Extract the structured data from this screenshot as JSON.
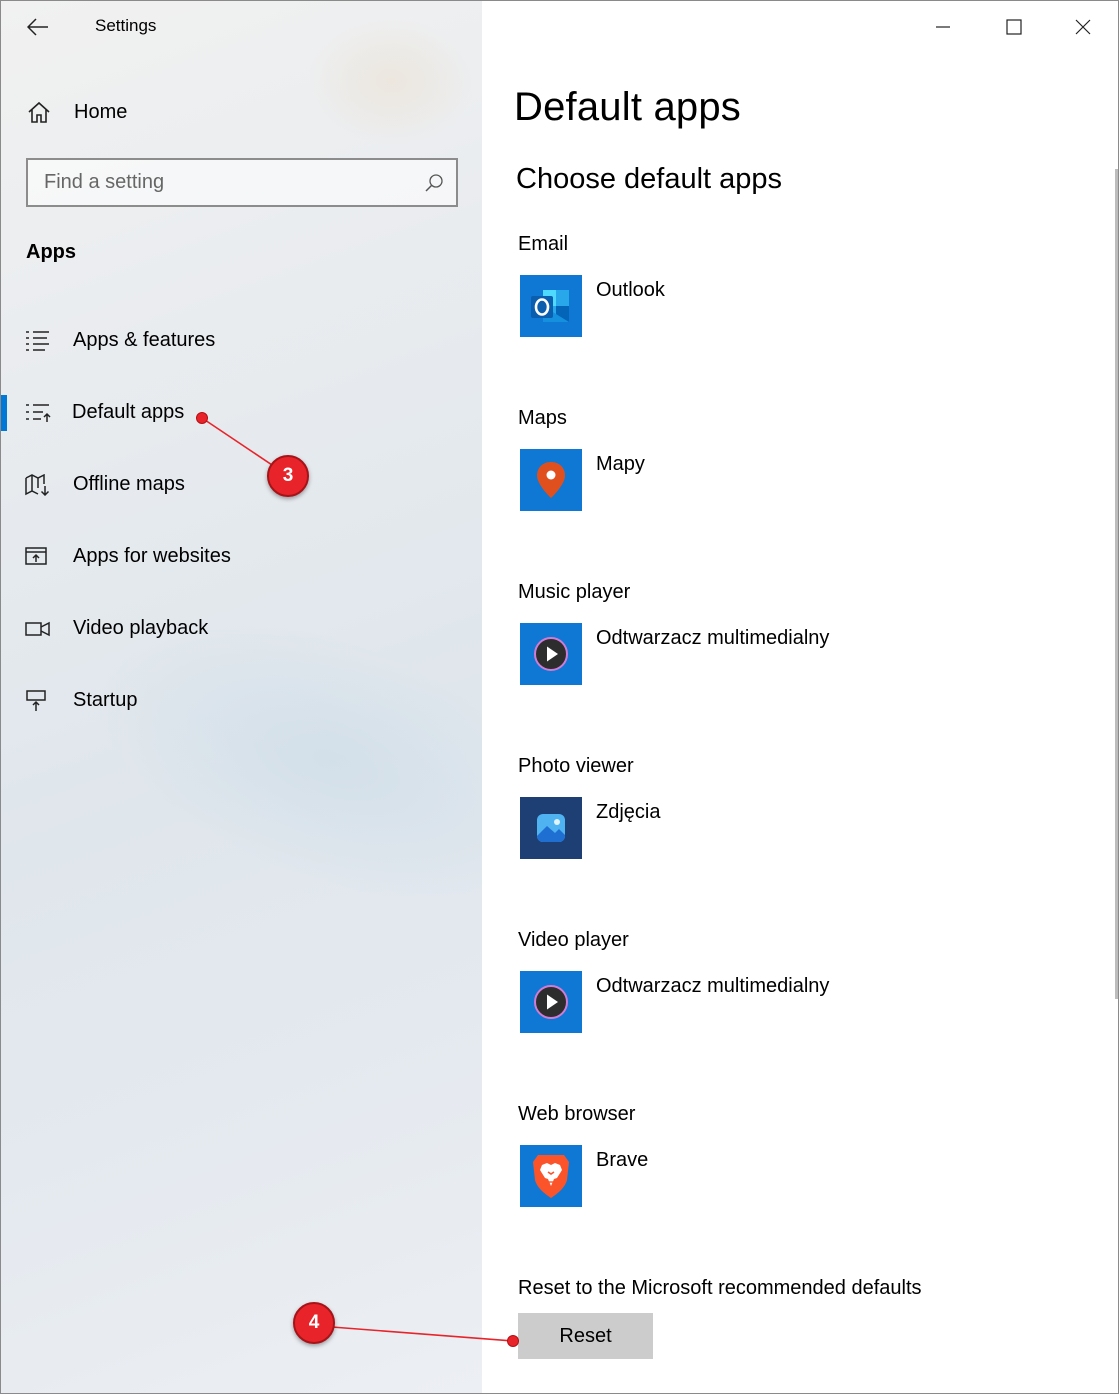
{
  "window": {
    "title": "Settings"
  },
  "left": {
    "home_label": "Home",
    "search_placeholder": "Find a setting",
    "section_title": "Apps",
    "nav": [
      {
        "label": "Apps & features",
        "icon": "list-icon",
        "selected": false
      },
      {
        "label": "Default apps",
        "icon": "default-apps-icon",
        "selected": true
      },
      {
        "label": "Offline maps",
        "icon": "offline-maps-icon",
        "selected": false
      },
      {
        "label": "Apps for websites",
        "icon": "apps-for-websites-icon",
        "selected": false
      },
      {
        "label": "Video playback",
        "icon": "video-camera-icon",
        "selected": false
      },
      {
        "label": "Startup",
        "icon": "startup-icon",
        "selected": false
      }
    ]
  },
  "main": {
    "title": "Default apps",
    "subtitle": "Choose default apps",
    "defaults": [
      {
        "category": "Email",
        "app": "Outlook",
        "icon": "outlook-icon",
        "tile_color": "#0f78d4"
      },
      {
        "category": "Maps",
        "app": "Mapy",
        "icon": "maps-pin-icon",
        "tile_color": "#0f78d4"
      },
      {
        "category": "Music player",
        "app": "Odtwarzacz multimedialny",
        "icon": "media-player-icon",
        "tile_color": "#0f78d4"
      },
      {
        "category": "Photo viewer",
        "app": "Zdjęcia",
        "icon": "photos-icon",
        "tile_color": "#1d3f73"
      },
      {
        "category": "Video player",
        "app": "Odtwarzacz multimedialny",
        "icon": "media-player-icon",
        "tile_color": "#0f78d4"
      },
      {
        "category": "Web browser",
        "app": "Brave",
        "icon": "brave-lion-icon",
        "tile_color": "#0f78d4"
      }
    ],
    "reset_label": "Reset to the Microsoft recommended defaults",
    "reset_button": "Reset"
  },
  "annotations": [
    {
      "number": "3",
      "color": "#e8242a"
    },
    {
      "number": "4",
      "color": "#e8242a"
    }
  ],
  "colors": {
    "accent": "#0078d7",
    "annotation": "#e8242a"
  }
}
